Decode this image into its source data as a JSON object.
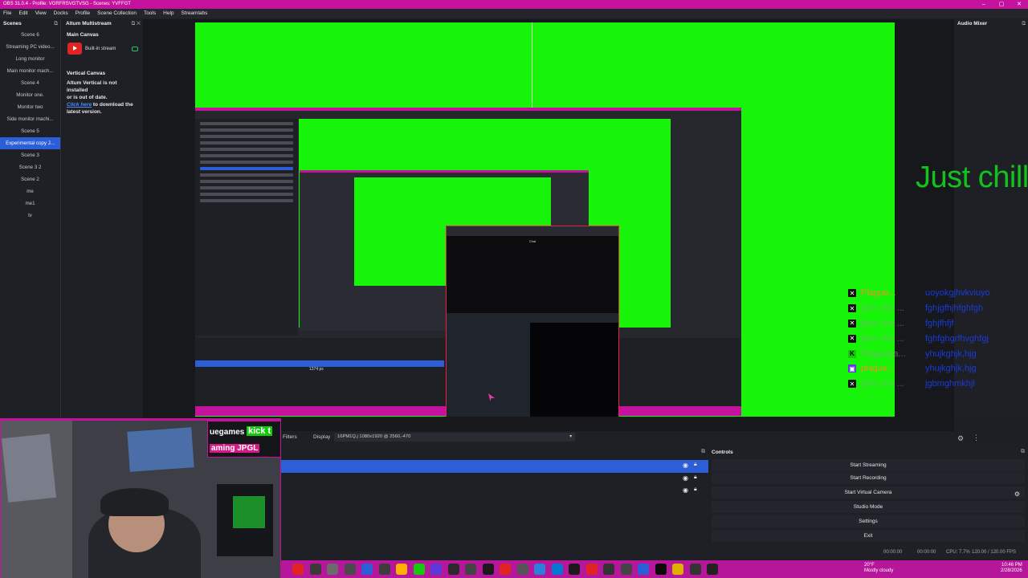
{
  "window": {
    "title": "OBS 31.0.4 - Profile: VGRFRSVGTVSG - Scenes: YVFFGT",
    "controls": [
      "–",
      "▢",
      "✕"
    ]
  },
  "menu": [
    "File",
    "Edit",
    "View",
    "Docks",
    "Profile",
    "Scene Collection",
    "Tools",
    "Help",
    "Streamlabs"
  ],
  "scenes": {
    "title": "Scenes",
    "items": [
      "Scene 6",
      "Streaming PC video...",
      "Long monitor",
      "Main monitor mach...",
      "Scene 4",
      "Monitor one.",
      "Monitor two",
      "Side monitor machi...",
      "Scene 5",
      "Experimental copy J...",
      "Scene 3",
      "Scene 3 2",
      "Scene 2",
      "me",
      "me1",
      "tv"
    ],
    "active_index": 9
  },
  "altum": {
    "title": "Altum Multistream",
    "main_canvas": "Main Canvas",
    "builtin_stream": "Built-in stream",
    "vertical_canvas": "Vertical Canvas",
    "warning_line1": "Altum Vertical is not installed",
    "warning_line2": "or is out of date.",
    "warning_link": "Click here",
    "warning_line3": " to download the",
    "warning_line4": "latest version."
  },
  "audio_mixer": {
    "title": "Audio Mixer"
  },
  "preview": {
    "overlay_text": "Just chill",
    "nested_label_size": "1374 px"
  },
  "chat": [
    {
      "platform": "x",
      "icon": "x-icon",
      "user": "Plague...",
      "user_color": "orange",
      "message": "uoyokgjhvkviuyo"
    },
    {
      "platform": "x",
      "icon": "x-icon",
      "user": "john cho ...",
      "user_color": "gray",
      "message": "fghjgfhjhfghfgh"
    },
    {
      "platform": "x",
      "icon": "x-icon",
      "user": "john cho ...",
      "user_color": "gray",
      "message": "fghjfhfjf"
    },
    {
      "platform": "x",
      "icon": "x-icon",
      "user": "john cho ...",
      "user_color": "gray",
      "message": "fghfghgrfhvghfgj"
    },
    {
      "platform": "kick",
      "icon": "kick-icon",
      "user": "Plaguega...",
      "user_color": "gray",
      "message": "yhujkghjk,hjg"
    },
    {
      "platform": "twitch",
      "icon": "twitch-icon",
      "user": "plague...",
      "user_color": "orange",
      "message": "yhujkghjk,hjg"
    },
    {
      "platform": "x",
      "icon": "x-icon",
      "user": "john cho ...",
      "user_color": "gray",
      "message": "jgbmghmkhjl"
    }
  ],
  "preview_toolbar": {
    "filters": "Filters",
    "display_label": "Display",
    "display_value": "16PM1Q.j 1080x1920 @ 2560,-470"
  },
  "sources": {
    "rows": [
      {
        "name": "",
        "selected": true
      },
      {
        "name": "",
        "selected": false
      },
      {
        "name": "",
        "selected": false
      }
    ]
  },
  "controls": {
    "title": "Controls",
    "buttons": [
      "Start Streaming",
      "Start Recording",
      "Start Virtual Camera",
      "Studio Mode",
      "Settings",
      "Exit"
    ]
  },
  "status": {
    "stream_time": "00:00:00",
    "record_time": "00:00:00",
    "cpu": "CPU: 7.7%",
    "fps": "120.00 / 120.00 FPS"
  },
  "webcam_alert": {
    "line1": "uegames",
    "kick": "kick t",
    "line2": "aming JPGL"
  },
  "taskbar": {
    "weather_temp": "20°F",
    "weather_desc": "Mostly cloudy",
    "time": "10:46 PM",
    "date": "2/28/2026"
  },
  "colors": {
    "accent": "#c4129f",
    "green_screen": "#17f40a",
    "selection": "#2c5ed8",
    "chat_message": "#1a3ad8"
  }
}
